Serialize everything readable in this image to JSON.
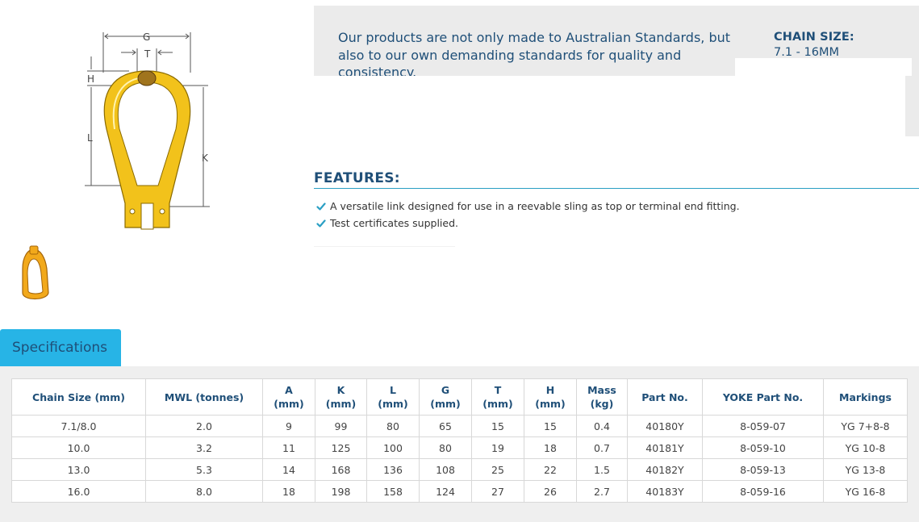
{
  "intro": {
    "text": "Our products are not only made to Australian Standards, but also to our own demanding standards for quality and consistency.",
    "chain_size_title": "CHAIN SIZE:",
    "chain_size_value": "7.1 - 16MM"
  },
  "diagram": {
    "labels": {
      "g": "G",
      "t": "T",
      "h": "H",
      "l": "L",
      "k": "K"
    }
  },
  "features": {
    "title": "FEATURES:",
    "items": [
      "A versatile link designed for use in a reevable sling as top or terminal end fitting.",
      "Test certificates supplied."
    ]
  },
  "tabs": {
    "specifications": "Specifications"
  },
  "specs": {
    "headers": [
      [
        "Chain Size (mm)"
      ],
      [
        "MWL (tonnes)"
      ],
      [
        "A",
        "(mm)"
      ],
      [
        "K",
        "(mm)"
      ],
      [
        "L",
        "(mm)"
      ],
      [
        "G",
        "(mm)"
      ],
      [
        "T",
        "(mm)"
      ],
      [
        "H",
        "(mm)"
      ],
      [
        "Mass",
        "(kg)"
      ],
      [
        "Part No."
      ],
      [
        "YOKE Part No."
      ],
      [
        "Markings"
      ]
    ],
    "rows": [
      [
        "7.1/8.0",
        "2.0",
        "9",
        "99",
        "80",
        "65",
        "15",
        "15",
        "0.4",
        "40180Y",
        "8-059-07",
        "YG 7+8-8"
      ],
      [
        "10.0",
        "3.2",
        "11",
        "125",
        "100",
        "80",
        "19",
        "18",
        "0.7",
        "40181Y",
        "8-059-10",
        "YG 10-8"
      ],
      [
        "13.0",
        "5.3",
        "14",
        "168",
        "136",
        "108",
        "25",
        "22",
        "1.5",
        "40182Y",
        "8-059-13",
        "YG 13-8"
      ],
      [
        "16.0",
        "8.0",
        "18",
        "198",
        "158",
        "124",
        "27",
        "26",
        "2.7",
        "40183Y",
        "8-059-16",
        "YG 16-8"
      ]
    ]
  },
  "colors": {
    "brand_navy": "#1f4f78",
    "accent_blue": "#27b4e6",
    "product_yellow": "#f2c21b",
    "check_blue": "#2a9fc4"
  },
  "icons": {
    "check": "check-icon",
    "diagram": "pear-link-diagram",
    "thumbnail": "pear-link-thumbnail"
  }
}
